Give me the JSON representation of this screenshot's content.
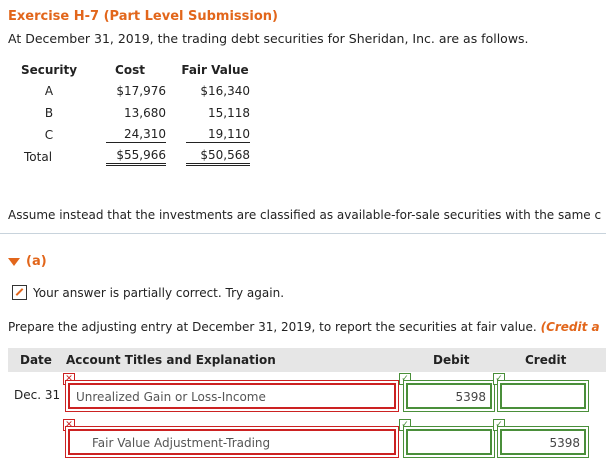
{
  "header": {
    "title": "Exercise H-7 (Part Level Submission)",
    "intro": "At December 31, 2019, the trading debt securities for Sheridan, Inc. are as follows."
  },
  "securities_table": {
    "headers": {
      "security": "Security",
      "cost": "Cost",
      "fair_value": "Fair Value"
    },
    "rows": [
      {
        "security": "A",
        "cost": "$17,976",
        "fair_value": "$16,340"
      },
      {
        "security": "B",
        "cost": "13,680",
        "fair_value": "15,118"
      },
      {
        "security": "C",
        "cost": "24,310",
        "fair_value": "19,110"
      }
    ],
    "total": {
      "label": "Total",
      "cost": "$55,966",
      "fair_value": "$50,568"
    }
  },
  "assume_text": "Assume instead that the investments are classified as available-for-sale securities with the same c",
  "part": {
    "label": "(a)",
    "feedback": "Your answer is partially correct.  Try again.",
    "prepare_text": "Prepare the adjusting entry at December 31, 2019, to report the securities at fair value.",
    "prepare_hint": "(Credit a"
  },
  "journal": {
    "headers": {
      "date": "Date",
      "account": "Account Titles and Explanation",
      "debit": "Debit",
      "credit": "Credit"
    },
    "rows": [
      {
        "date": "Dec. 31",
        "account": "Unrealized Gain or Loss-Income",
        "debit": "5398",
        "credit": ""
      },
      {
        "date": "",
        "account": "Fair Value Adjustment-Trading",
        "debit": "",
        "credit": "5398"
      }
    ]
  },
  "colors": {
    "accent": "#e2661b",
    "incorrect": "#cc2222",
    "correct": "#4a8f3a"
  },
  "icons": {
    "incorrect": "x-mark-icon",
    "correct": "check-mark-icon",
    "feedback": "pencil-icon",
    "expand": "triangle-down-icon"
  }
}
